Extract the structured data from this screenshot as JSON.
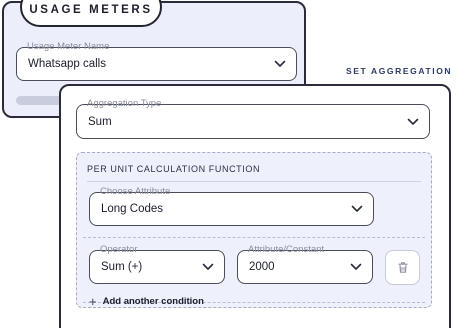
{
  "usage_meters": {
    "tab_label": "USAGE METERS",
    "meter_name_label": "Usage Meter Name",
    "meter_name_value": "Whatsapp calls"
  },
  "set_aggregation_label": "SET AGGREGATION",
  "aggregation": {
    "type_label": "Aggregation Type",
    "type_value": "Sum",
    "calc_title": "PER UNIT CALCULATION FUNCTION",
    "attribute_label": "Choose Attribute",
    "attribute_value": "Long Codes",
    "operator_label": "Operator",
    "operator_value": "Sum (+)",
    "constant_label": "Attribute/Constant",
    "constant_value": "2000",
    "add_condition_label": "Add another condition"
  },
  "icons": {
    "dropdown": "chevron-down-icon",
    "delete": "trash-icon",
    "add": "plus-icon"
  },
  "colors": {
    "back_card_bg": "#eceefc",
    "calc_box_bg": "#eef0fb",
    "accent_label": "#2b3a6a",
    "border_dark": "#2a2c3a"
  }
}
